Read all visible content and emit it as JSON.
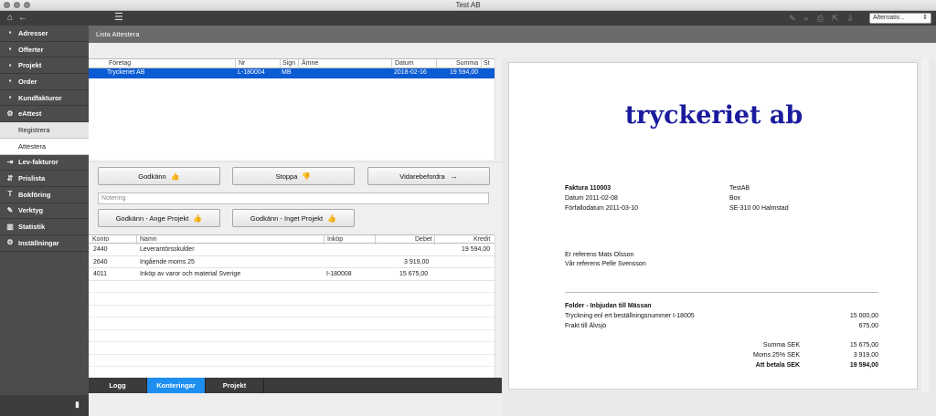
{
  "window": {
    "title": "Test AB"
  },
  "toolbar": {
    "alt_select": "Alternativ..."
  },
  "sidebar": {
    "items": [
      {
        "label": "Adresser",
        "icon": "address-icon",
        "glyph": "▪"
      },
      {
        "label": "Offerter",
        "icon": "offer-icon",
        "glyph": "▪"
      },
      {
        "label": "Projekt",
        "icon": "project-icon",
        "glyph": "▪"
      },
      {
        "label": "Order",
        "icon": "order-icon",
        "glyph": "▪"
      },
      {
        "label": "Kundfakturor",
        "icon": "invoice-icon",
        "glyph": "▪"
      },
      {
        "label": "eAttest",
        "icon": "gear-icon",
        "glyph": "⚙"
      }
    ],
    "sub_items": [
      {
        "label": "Registrera"
      },
      {
        "label": "Attestera"
      }
    ],
    "items2": [
      {
        "label": "Lev-fakturor",
        "icon": "supplier-invoice-icon",
        "glyph": "⇥"
      },
      {
        "label": "Prislista",
        "icon": "pricelist-icon",
        "glyph": "⇵"
      },
      {
        "label": "Bokföring",
        "icon": "bookkeeping-icon",
        "glyph": "T"
      },
      {
        "label": "Verktyg",
        "icon": "tools-icon",
        "glyph": "✎"
      },
      {
        "label": "Statistik",
        "icon": "statistics-icon",
        "glyph": "▥"
      },
      {
        "label": "Inställningar",
        "icon": "settings-icon",
        "glyph": "⚙"
      }
    ]
  },
  "subheader": {
    "title": "Lista Attestera"
  },
  "invoice_list": {
    "columns": [
      "Företag",
      "Nr",
      "Sign",
      "Ämne",
      "Datum",
      "Summa",
      "St"
    ],
    "rows": [
      {
        "company": "Tryckeriet AB",
        "nr": "L-180004",
        "sign": "MB",
        "subject": "",
        "date": "2018-02-16",
        "sum": "19 594,00",
        "status": ""
      }
    ]
  },
  "actions": {
    "approve": "Godkänn",
    "stop": "Stoppa",
    "forward": "Vidarebefordra",
    "note_placeholder": "Notering",
    "approve_project": "Godkänn - Ange Projekt",
    "approve_no_project": "Godkänn - Inget Projekt"
  },
  "accounts": {
    "columns": [
      "Konto",
      "Namn",
      "Inköp",
      "Debet",
      "Kredit"
    ],
    "rows": [
      {
        "konto": "2440",
        "namn": "Leverantörsskulder",
        "inkop": "",
        "debet": "",
        "kredit": "19 594,00"
      },
      {
        "konto": "2640",
        "namn": "Ingående moms 25",
        "inkop": "",
        "debet": "3 919,00",
        "kredit": ""
      },
      {
        "konto": "4011",
        "namn": "Inköp av varor och material Sverige",
        "inkop": "I-180008",
        "debet": "15 675,00",
        "kredit": ""
      }
    ]
  },
  "tabs": [
    {
      "label": "Logg",
      "active": false
    },
    {
      "label": "Konteringar",
      "active": true
    },
    {
      "label": "Projekt",
      "active": false
    }
  ],
  "document": {
    "logo": "tryckeriet ab",
    "invoice_title": "Faktura 110003",
    "date": "Datum 2011-02-08",
    "due": "Förfallodatum 2011-03-10",
    "recipient_name": "TestAB",
    "recipient_box": "Box",
    "recipient_city": "SE-310 00  Halmstad",
    "our_ref": "Er referens  Mats Olsson",
    "your_ref": "Vår referens  Pelle Svensson",
    "heading": "Folder - Inbjudan till Mässan",
    "line1_text": "Tryckning enl ert beställningsnummer I-18005",
    "line1_amount": "15 000,00",
    "line2_text": "Frakt till Älvsjö",
    "line2_amount": "675,00",
    "sum_label": "Summa SEK",
    "sum_value": "15 675,00",
    "vat_label": "Moms 25% SEK",
    "vat_value": "3 919,00",
    "total_label": "Att betala SEK",
    "total_value": "19 594,00"
  }
}
